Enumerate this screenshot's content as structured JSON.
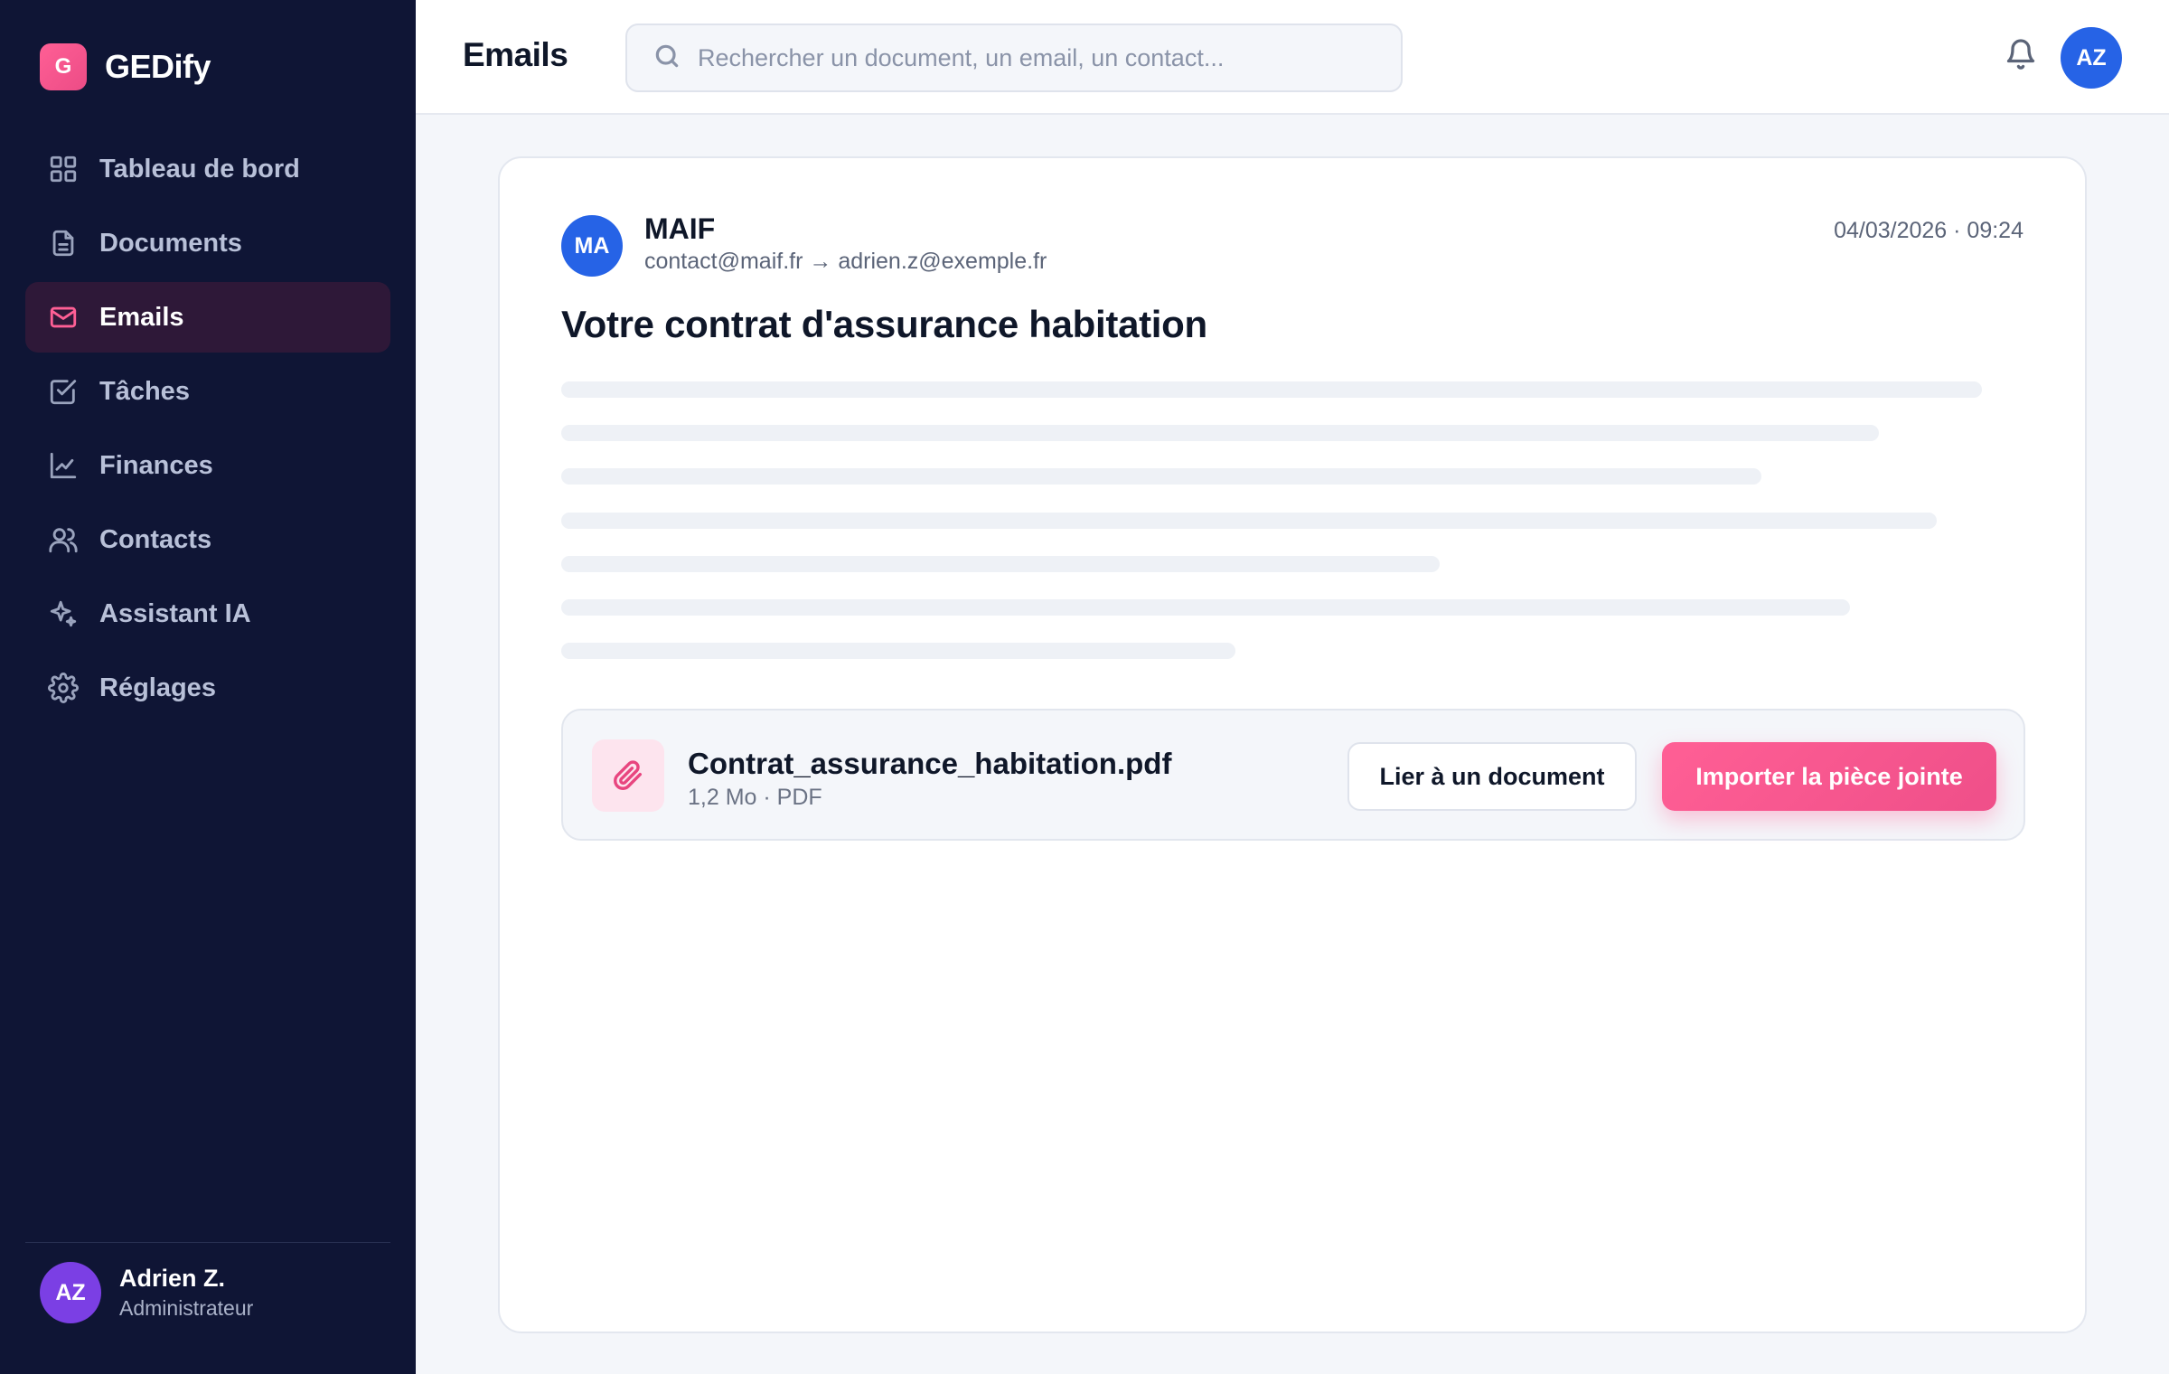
{
  "app": {
    "logo_letter": "G",
    "name": "GEDify"
  },
  "sidebar": {
    "items": [
      {
        "label": "Tableau de bord",
        "icon": "grid-icon",
        "active": false
      },
      {
        "label": "Documents",
        "icon": "file-icon",
        "active": false
      },
      {
        "label": "Emails",
        "icon": "mail-icon",
        "active": true
      },
      {
        "label": "Tâches",
        "icon": "checkbox-icon",
        "active": false
      },
      {
        "label": "Finances",
        "icon": "chart-line-icon",
        "active": false
      },
      {
        "label": "Contacts",
        "icon": "users-icon",
        "active": false
      },
      {
        "label": "Assistant IA",
        "icon": "sparkles-icon",
        "active": false
      },
      {
        "label": "Réglages",
        "icon": "gear-icon",
        "active": false
      }
    ],
    "user": {
      "initials": "AZ",
      "name": "Adrien Z.",
      "role": "Administrateur"
    }
  },
  "header": {
    "title": "Emails",
    "search_placeholder": "Rechercher un document, un email, un contact...",
    "user_initials": "AZ"
  },
  "email": {
    "sender_initials": "MA",
    "sender_name": "MAIF",
    "route": "contact@maif.fr → adrien.z@exemple.fr",
    "date": "04/03/2026 · 09:24",
    "subject": "Votre contrat d'assurance habitation",
    "attachment": {
      "name": "Contrat_assurance_habitation.pdf",
      "meta": "1,2 Mo · PDF",
      "link_label": "Lier à un document",
      "import_label": "Importer la pièce jointe"
    }
  },
  "colors": {
    "sidebar_bg": "#0f1535",
    "accent": "#ff5f95",
    "primary_blue": "#2663e6",
    "user_purple": "#7b3fe4"
  }
}
